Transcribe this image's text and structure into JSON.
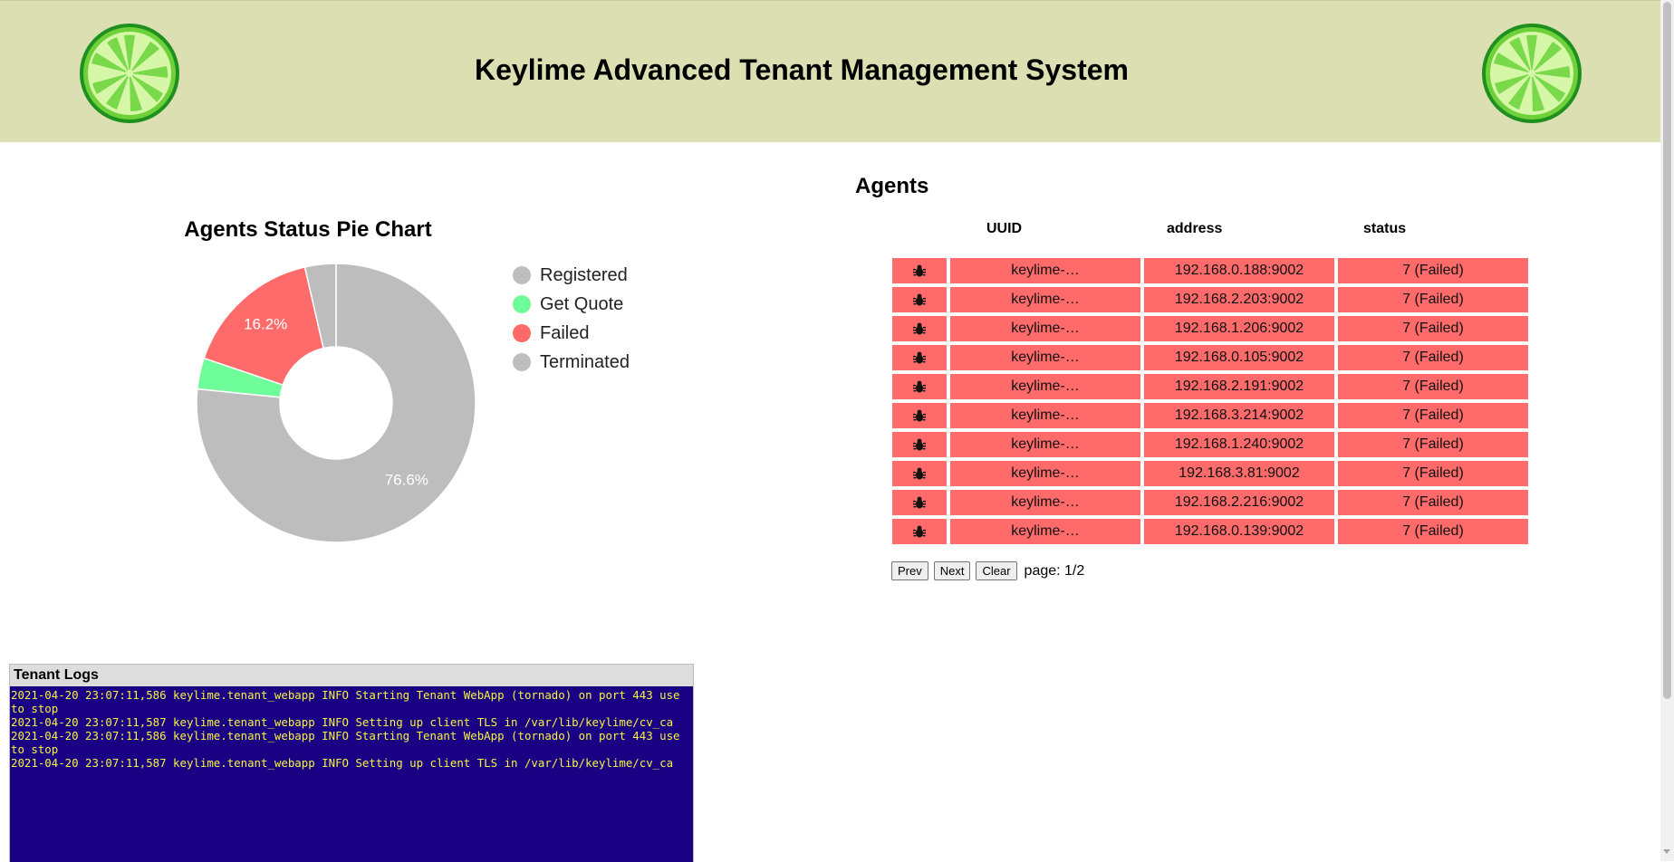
{
  "header": {
    "title": "Keylime Advanced Tenant Management System"
  },
  "chart": {
    "title": "Agents Status Pie Chart",
    "colors": {
      "Registered": "#bdbdbd",
      "Get Quote": "#6efd9a",
      "Failed": "#ff6b6b",
      "Terminated": "#bdbdbd"
    }
  },
  "chart_data": {
    "type": "pie",
    "title": "Agents Status Pie Chart",
    "categories": [
      "Registered",
      "Get Quote",
      "Failed",
      "Terminated"
    ],
    "values": [
      76.6,
      3.6,
      16.2,
      3.6
    ],
    "labels": [
      "76.6%",
      "",
      "16.2%",
      ""
    ],
    "donut": true,
    "legend": "right"
  },
  "agents": {
    "title": "Agents",
    "columns": [
      "UUID",
      "address",
      "status"
    ],
    "row_color": "#ff6b6b",
    "row_icon": "bug-icon",
    "rows": [
      {
        "uuid": "keylime-…",
        "address": "192.168.0.188:9002",
        "status": "7 (Failed)"
      },
      {
        "uuid": "keylime-…",
        "address": "192.168.2.203:9002",
        "status": "7 (Failed)"
      },
      {
        "uuid": "keylime-…",
        "address": "192.168.1.206:9002",
        "status": "7 (Failed)"
      },
      {
        "uuid": "keylime-…",
        "address": "192.168.0.105:9002",
        "status": "7 (Failed)"
      },
      {
        "uuid": "keylime-…",
        "address": "192.168.2.191:9002",
        "status": "7 (Failed)"
      },
      {
        "uuid": "keylime-…",
        "address": "192.168.3.214:9002",
        "status": "7 (Failed)"
      },
      {
        "uuid": "keylime-…",
        "address": "192.168.1.240:9002",
        "status": "7 (Failed)"
      },
      {
        "uuid": "keylime-…",
        "address": "192.168.3.81:9002",
        "status": "7 (Failed)"
      },
      {
        "uuid": "keylime-…",
        "address": "192.168.2.216:9002",
        "status": "7 (Failed)"
      },
      {
        "uuid": "keylime-…",
        "address": "192.168.0.139:9002",
        "status": "7 (Failed)"
      }
    ],
    "pager": {
      "prev": "Prev",
      "next": "Next",
      "clear": "Clear",
      "page": "page: 1/2"
    }
  },
  "logs": {
    "title": "Tenant Logs",
    "lines": [
      "2021-04-20 23:07:11,586 keylime.tenant_webapp INFO Starting Tenant WebApp (tornado) on port 443 use to stop",
      "2021-04-20 23:07:11,587 keylime.tenant_webapp INFO Setting up client TLS in /var/lib/keylime/cv_ca",
      "2021-04-20 23:07:11,586 keylime.tenant_webapp INFO Starting Tenant WebApp (tornado) on port 443 use to stop",
      "2021-04-20 23:07:11,587 keylime.tenant_webapp INFO Setting up client TLS in /var/lib/keylime/cv_ca"
    ]
  }
}
